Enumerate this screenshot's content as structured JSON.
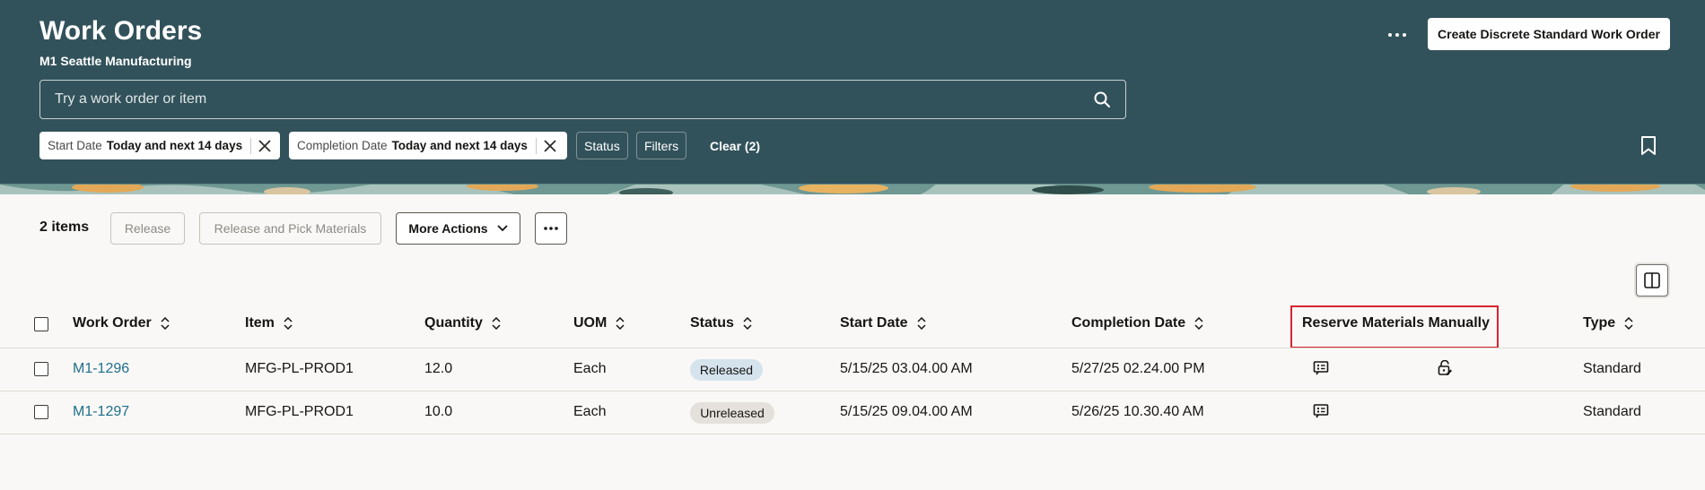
{
  "header": {
    "title": "Work Orders",
    "subtitle": "M1 Seattle Manufacturing",
    "more_icon": "ellipsis-horizontal-icon",
    "create_button": "Create Discrete Standard Work Order",
    "search_placeholder": "Try a work order or item",
    "filters": [
      {
        "label": "Start Date",
        "value": "Today and next 14 days"
      },
      {
        "label": "Completion Date",
        "value": "Today and next 14 days"
      }
    ],
    "status_filter": "Status",
    "filters_button": "Filters",
    "clear_label": "Clear (2)"
  },
  "toolbar": {
    "items_count": "2 items",
    "release": "Release",
    "release_pick": "Release and Pick Materials",
    "more_actions": "More Actions"
  },
  "table": {
    "columns": [
      "Work Order",
      "Item",
      "Quantity",
      "UOM",
      "Status",
      "Start Date",
      "Completion Date",
      "Reserve Materials Manually",
      "Type"
    ],
    "rows": [
      {
        "work_order": "M1-1296",
        "item": "MFG-PL-PROD1",
        "quantity": "12.0",
        "uom": "Each",
        "status": "Released",
        "start_date": "5/15/25 03.04.00 AM",
        "completion_date": "5/27/25 02.24.00 PM",
        "type": "Standard",
        "icons": [
          "reserve-materials-icon",
          "lock-edit-icon"
        ]
      },
      {
        "work_order": "M1-1297",
        "item": "MFG-PL-PROD1",
        "quantity": "10.0",
        "uom": "Each",
        "status": "Unreleased",
        "start_date": "5/15/25 09.04.00 AM",
        "completion_date": "5/26/25 10.30.40 AM",
        "type": "Standard",
        "icons": [
          "reserve-materials-icon"
        ]
      }
    ]
  },
  "colors": {
    "header_bg": "#32525b",
    "link": "#1f6f8b",
    "highlight": "#d6242e"
  }
}
